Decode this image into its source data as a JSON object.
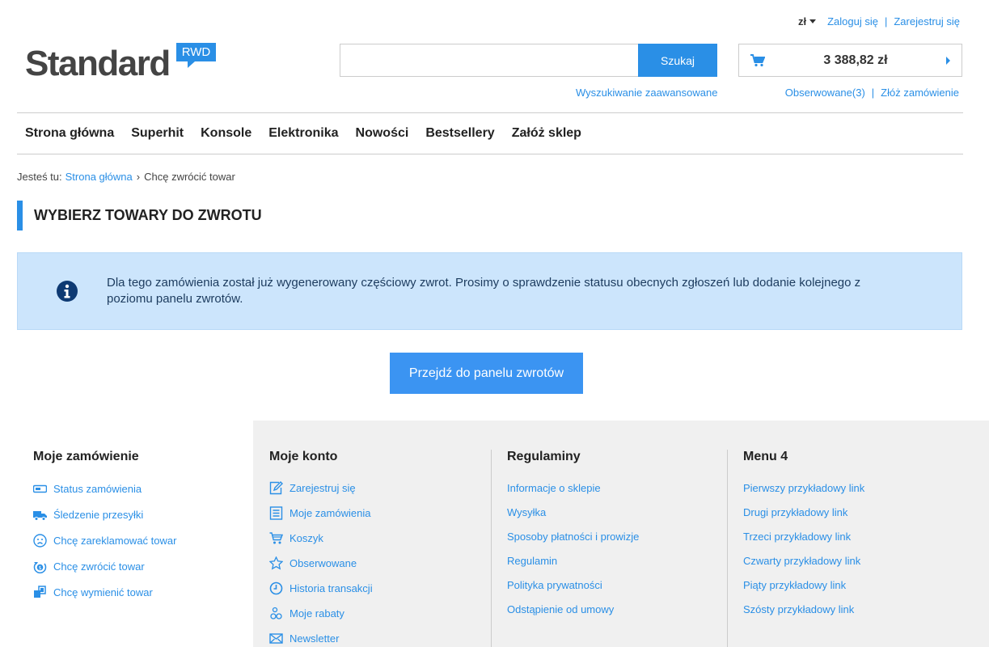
{
  "topbar": {
    "currency": "zł",
    "login": "Zaloguj się",
    "separator": "|",
    "register": "Zarejestruj się"
  },
  "logo": {
    "text": "Standard",
    "badge": "RWD"
  },
  "search": {
    "value": "",
    "button": "Szukaj",
    "advanced": "Wyszukiwanie zaawansowane"
  },
  "cart": {
    "total": "3 388,82 zł",
    "observed": "Obserwowane(3)",
    "separator": "|",
    "quick_order": "Złóż zamówienie"
  },
  "nav": {
    "items": [
      "Strona główna",
      "Superhit",
      "Konsole",
      "Elektronika",
      "Nowości",
      "Bestsellery",
      "Załóż sklep"
    ]
  },
  "breadcrumb": {
    "prefix": "Jesteś tu:",
    "home": "Strona główna",
    "separator": "›",
    "current": "Chcę zwrócić towar"
  },
  "page": {
    "title": "WYBIERZ TOWARY DO ZWROTU",
    "info_message": "Dla tego zamówienia został już wygenerowany częściowy zwrot. Prosimy o sprawdzenie statusu obecnych zgłoszeń lub dodanie kolejnego z poziomu panelu zwrotów.",
    "cta": "Przejdź do panelu zwrotów"
  },
  "footer": {
    "columns": [
      {
        "title": "Moje zamówienie",
        "items": [
          {
            "label": "Status zamówienia",
            "icon": "status-icon"
          },
          {
            "label": "Śledzenie przesyłki",
            "icon": "truck-icon"
          },
          {
            "label": "Chcę zareklamować towar",
            "icon": "sad-face-icon"
          },
          {
            "label": "Chcę zwrócić towar",
            "icon": "return-icon"
          },
          {
            "label": "Chcę wymienić towar",
            "icon": "exchange-icon"
          }
        ]
      },
      {
        "title": "Moje konto",
        "items": [
          {
            "label": "Zarejestruj się",
            "icon": "edit-icon"
          },
          {
            "label": "Moje zamówienia",
            "icon": "list-icon"
          },
          {
            "label": "Koszyk",
            "icon": "cart-icon"
          },
          {
            "label": "Obserwowane",
            "icon": "star-icon"
          },
          {
            "label": "Historia transakcji",
            "icon": "clock-icon"
          },
          {
            "label": "Moje rabaty",
            "icon": "discount-icon"
          },
          {
            "label": "Newsletter",
            "icon": "envelope-icon"
          }
        ]
      },
      {
        "title": "Regulaminy",
        "items": [
          {
            "label": "Informacje o sklepie"
          },
          {
            "label": "Wysyłka"
          },
          {
            "label": "Sposoby płatności i prowizje"
          },
          {
            "label": "Regulamin"
          },
          {
            "label": "Polityka prywatności"
          },
          {
            "label": "Odstąpienie od umowy"
          }
        ]
      },
      {
        "title": "Menu 4",
        "items": [
          {
            "label": "Pierwszy przykładowy link"
          },
          {
            "label": "Drugi przykładowy link"
          },
          {
            "label": "Trzeci przykładowy link"
          },
          {
            "label": "Czwarty przykładowy link"
          },
          {
            "label": "Piąty przykładowy link"
          },
          {
            "label": "Szósty przykładowy link"
          }
        ]
      }
    ]
  },
  "colors": {
    "accent": "#2a8fe6",
    "info_bg": "#cce5fc",
    "footer_bg": "#f0f0f0"
  }
}
